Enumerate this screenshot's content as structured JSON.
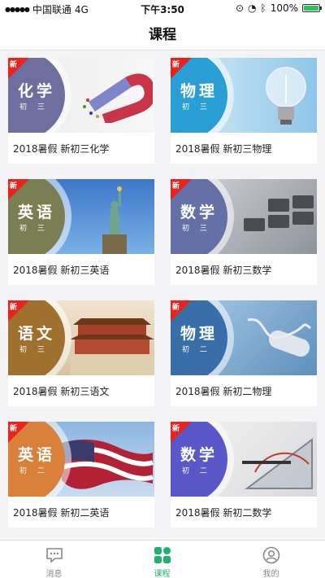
{
  "status_bar": {
    "carrier": "中国联通",
    "network": "4G",
    "time": "下午3:50",
    "battery": "100%",
    "battery_level": 1.0
  },
  "nav": {
    "title": "课程"
  },
  "new_badge_label": "新",
  "courses": [
    {
      "subject": "化学",
      "grade": "初 三",
      "title": "2018暑假 新初三化学",
      "circle_color": "#6e6f9e",
      "bg": "linear-gradient(90deg,#ececec,#f7f7f7)",
      "image": "magnet"
    },
    {
      "subject": "物理",
      "grade": "初 三",
      "title": "2018暑假 新初三物理",
      "circle_color": "#2a9fd6",
      "bg": "linear-gradient(90deg,#d9ecf7,#8ec6e8)",
      "image": "bulb"
    },
    {
      "subject": "英语",
      "grade": "初 三",
      "title": "2018暑假 新初三英语",
      "circle_color": "#7b7d53",
      "bg": "linear-gradient(180deg,#3d77c8,#7ab1e6)",
      "image": "liberty"
    },
    {
      "subject": "数学",
      "grade": "初 三",
      "title": "2018暑假 新初三数学",
      "circle_color": "#6470a6",
      "bg": "linear-gradient(135deg,#d3d5da,#8f939b)",
      "image": "keyboard"
    },
    {
      "subject": "语文",
      "grade": "初 三",
      "title": "2018暑假 新初三语文",
      "circle_color": "#a0702f",
      "bg": "linear-gradient(180deg,#f1e4cf,#d9c29e)",
      "image": "palace"
    },
    {
      "subject": "物理",
      "grade": "初 二",
      "title": "2018暑假 新初二物理",
      "circle_color": "#3a6ea8",
      "bg": "linear-gradient(135deg,#a9cde8,#5f8fbd)",
      "image": "battery"
    },
    {
      "subject": "英语",
      "grade": "初 二",
      "title": "2018暑假 新初二英语",
      "circle_color": "#d9803a",
      "bg": "linear-gradient(180deg,#8cb6e2,#c9dcef)",
      "image": "flag"
    },
    {
      "subject": "数学",
      "grade": "初 二",
      "title": "2018暑假 新初二数学",
      "circle_color": "#5a57c8",
      "bg": "linear-gradient(135deg,#f4f4f4,#d9d9dc)",
      "image": "ruler"
    }
  ],
  "tab_bar": {
    "items": [
      {
        "label": "消息",
        "icon": "message-icon",
        "active": false
      },
      {
        "label": "课程",
        "icon": "course-grid-icon",
        "active": true
      },
      {
        "label": "我的",
        "icon": "profile-icon",
        "active": false
      }
    ],
    "active_color": "#20b26b",
    "inactive_color": "#888888"
  }
}
